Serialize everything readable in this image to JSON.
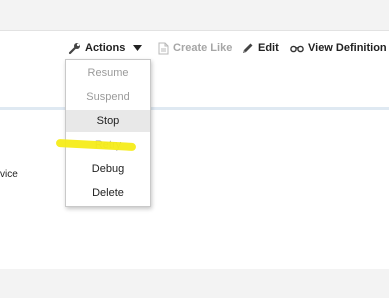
{
  "toolbar": {
    "actions_label": "Actions",
    "create_like_label": "Create Like",
    "edit_label": "Edit",
    "view_definition_label": "View Definition"
  },
  "actions_menu": {
    "items": [
      {
        "label": "Resume",
        "enabled": false
      },
      {
        "label": "Suspend",
        "enabled": false
      },
      {
        "label": "Stop",
        "enabled": true,
        "hovered": true
      },
      {
        "label": "Retry",
        "enabled": false,
        "highlighted": true
      },
      {
        "label": "Debug",
        "enabled": true
      },
      {
        "label": "Delete",
        "enabled": true
      }
    ]
  },
  "content": {
    "partial_text": "vice"
  },
  "colors": {
    "highlight": "#f5ec19",
    "disabled_text": "#9b9b9b",
    "hover_bg": "#e8e8e8"
  },
  "icons": {
    "actions": "wrench-icon",
    "actions_caret": "caret-down-icon",
    "create_like": "document-icon",
    "edit": "pencil-icon",
    "view_definition": "glasses-icon"
  }
}
